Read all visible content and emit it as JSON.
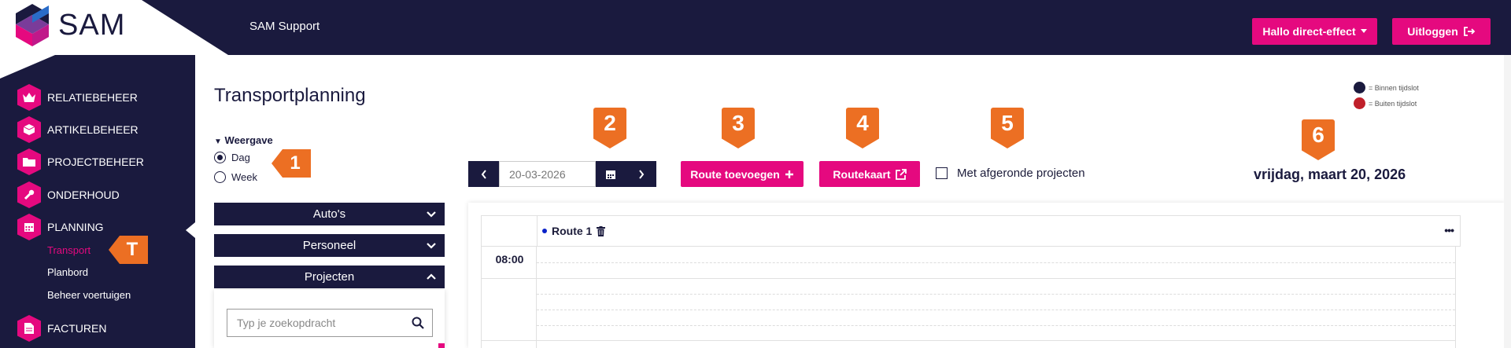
{
  "app": {
    "brand": "SAM",
    "support_label": "SAM Support"
  },
  "header": {
    "user_button": "Hallo direct-effect",
    "logout_button": "Uitloggen"
  },
  "sidebar": {
    "items": [
      {
        "label": "RELATIEBEHEER",
        "icon": "crown-icon"
      },
      {
        "label": "ARTIKELBEHEER",
        "icon": "box-icon"
      },
      {
        "label": "PROJECTBEHEER",
        "icon": "folder-icon"
      },
      {
        "label": "ONDERHOUD",
        "icon": "wrench-icon"
      },
      {
        "label": "PLANNING",
        "icon": "calendar-icon"
      },
      {
        "label": "FACTUREN",
        "icon": "document-icon"
      }
    ],
    "subitems": [
      {
        "label": "Transport",
        "active": true
      },
      {
        "label": "Planbord",
        "active": false
      },
      {
        "label": "Beheer voertuigen",
        "active": false
      }
    ],
    "tag": "T"
  },
  "main": {
    "title": "Transportplanning",
    "weergave_label": "Weergave",
    "view_options": [
      {
        "label": "Dag",
        "checked": true
      },
      {
        "label": "Week",
        "checked": false
      }
    ],
    "accordions": [
      {
        "label": "Auto's",
        "open": false
      },
      {
        "label": "Personeel",
        "open": false
      },
      {
        "label": "Projecten",
        "open": true
      }
    ],
    "search_placeholder": "Typ je zoekopdracht",
    "date_value": "20-03-2026",
    "route_add_label": "Route toevoegen",
    "routekaart_label": "Routekaart",
    "afgerond_label": "Met afgeronde projecten",
    "date_long": "vrijdag, maart 20, 2026",
    "legend": [
      {
        "label": "= Binnen tijdslot",
        "color": "#1a1a3e"
      },
      {
        "label": "= Buiten tijdslot",
        "color": "#c0202a"
      }
    ],
    "calendar": {
      "route_name": "Route 1",
      "first_time": "08:00",
      "more_label": "•••"
    }
  },
  "tags": {
    "view": "1",
    "date": "2",
    "route_add": "3",
    "routekaart": "4",
    "afgerond": "5",
    "date_long": "6"
  },
  "colors": {
    "navy": "#1a1a3e",
    "pink": "#e5097f",
    "orange": "#ec6f23"
  }
}
